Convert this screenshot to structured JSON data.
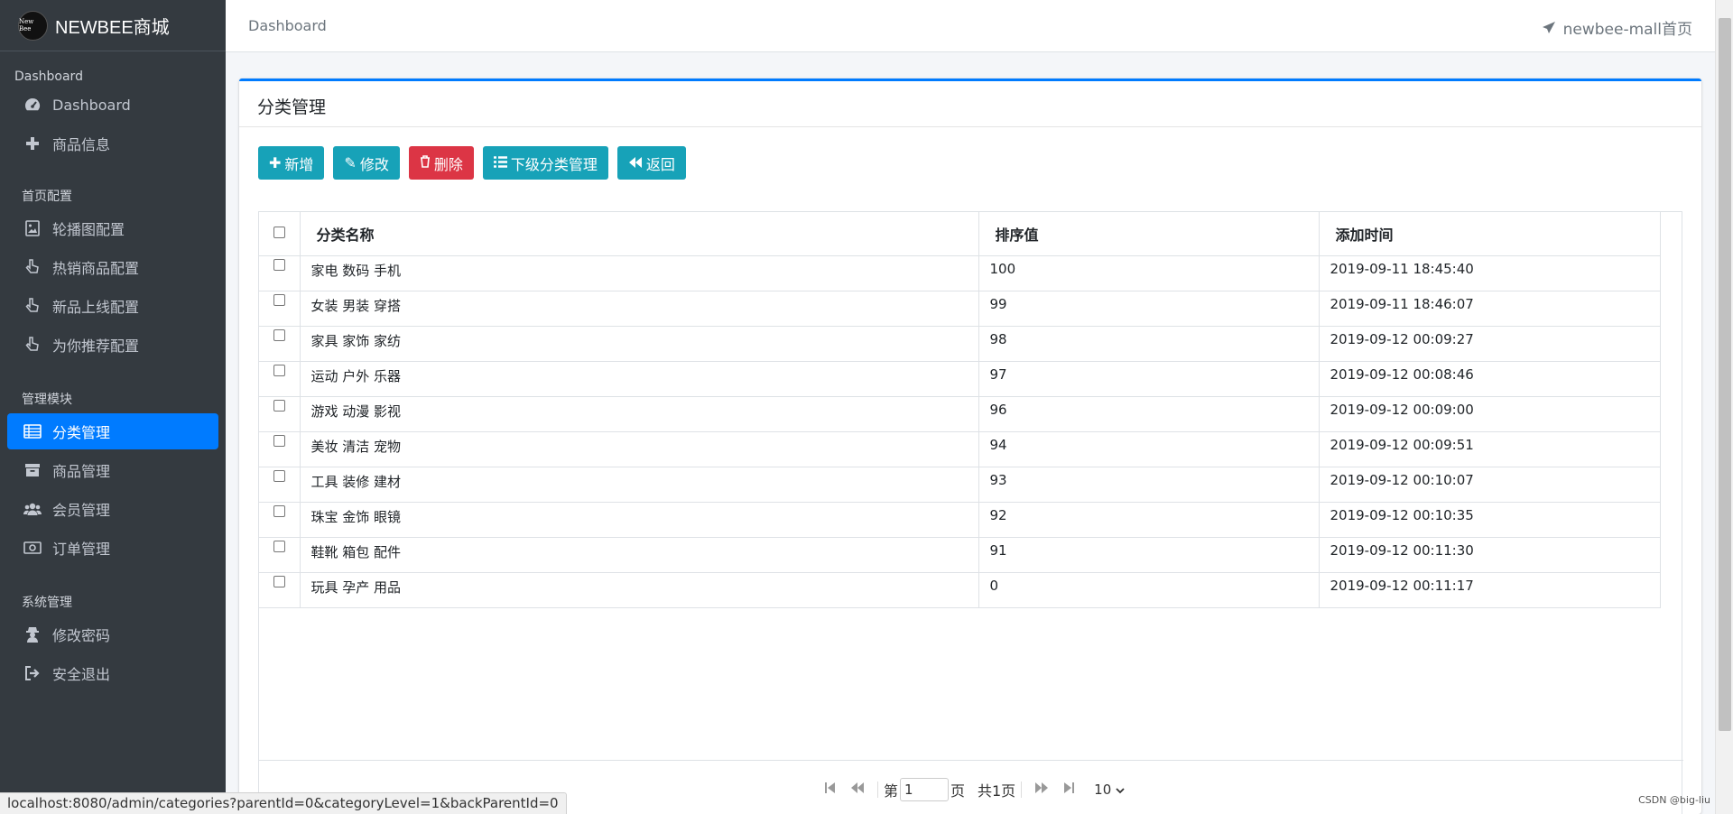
{
  "brand": {
    "logo_text": "New Bee",
    "title": "NEWBEE商城"
  },
  "sidebar": {
    "section_dashboard": "Dashboard",
    "dashboard_item": "Dashboard",
    "goods_info": "商品信息",
    "section_home": "首页配置",
    "carousel": "轮播图配置",
    "hot": "热销商品配置",
    "new": "新品上线配置",
    "recommend": "为你推荐配置",
    "section_manage": "管理模块",
    "category": "分类管理",
    "goods": "商品管理",
    "users": "会员管理",
    "orders": "订单管理",
    "section_system": "系统管理",
    "password": "修改密码",
    "logout": "安全退出"
  },
  "topbar": {
    "breadcrumb": "Dashboard",
    "home_link": "newbee-mall首页"
  },
  "card": {
    "title": "分类管理"
  },
  "toolbar": {
    "add": "新增",
    "edit": "修改",
    "delete": "删除",
    "sub": "下级分类管理",
    "back": "返回"
  },
  "table": {
    "headers": {
      "name": "分类名称",
      "rank": "排序值",
      "time": "添加时间"
    },
    "rows": [
      {
        "name": "家电 数码 手机",
        "rank": "100",
        "time": "2019-09-11 18:45:40"
      },
      {
        "name": "女装 男装 穿搭",
        "rank": "99",
        "time": "2019-09-11 18:46:07"
      },
      {
        "name": "家具 家饰 家纺",
        "rank": "98",
        "time": "2019-09-12 00:09:27"
      },
      {
        "name": "运动 户外 乐器",
        "rank": "97",
        "time": "2019-09-12 00:08:46"
      },
      {
        "name": "游戏 动漫 影视",
        "rank": "96",
        "time": "2019-09-12 00:09:00"
      },
      {
        "name": "美妆 清洁 宠物",
        "rank": "94",
        "time": "2019-09-12 00:09:51"
      },
      {
        "name": "工具 装修 建材",
        "rank": "93",
        "time": "2019-09-12 00:10:07"
      },
      {
        "name": "珠宝 金饰 眼镜",
        "rank": "92",
        "time": "2019-09-12 00:10:35"
      },
      {
        "name": "鞋靴 箱包 配件",
        "rank": "91",
        "time": "2019-09-12 00:11:30"
      },
      {
        "name": "玩具 孕产 用品",
        "rank": "0",
        "time": "2019-09-12 00:11:17"
      }
    ]
  },
  "pager": {
    "prefix": "第",
    "page": "1",
    "page_suffix": "页",
    "total": "共1页",
    "page_size": "10"
  },
  "status": {
    "url": "localhost:8080/admin/categories?parentId=0&categoryLevel=1&backParentId=0"
  },
  "watermark": "CSDN @big-liu",
  "colors": {
    "primary": "#007bff",
    "info": "#17a2b8",
    "danger": "#dc3545",
    "sidebar": "#343a40"
  }
}
